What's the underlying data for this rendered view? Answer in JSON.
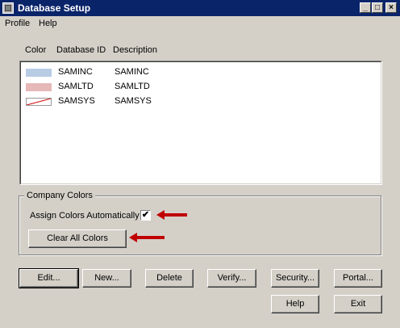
{
  "window": {
    "title": "Database Setup"
  },
  "titlebar": {
    "minimize": "_",
    "maximize": "□",
    "close": "×"
  },
  "menu": [
    "Profile",
    "Help"
  ],
  "list": {
    "headers": {
      "color": "Color",
      "id": "Database ID",
      "description": "Description"
    },
    "rows": [
      {
        "id": "SAMINC",
        "description": "SAMINC",
        "swatch": "#b8cce4"
      },
      {
        "id": "SAMLTD",
        "description": "SAMLTD",
        "swatch": "#e6b8b8"
      },
      {
        "id": "SAMSYS",
        "description": "SAMSYS",
        "swatch": "none"
      }
    ]
  },
  "company_colors": {
    "legend": "Company Colors",
    "assign_label": "Assign Colors Automatically",
    "assign_checked": "✔",
    "clear_button": "Clear All Colors"
  },
  "buttons": {
    "edit": "Edit...",
    "new": "New...",
    "delete": "Delete",
    "verify": "Verify...",
    "security": "Security...",
    "portal": "Portal...",
    "help": "Help",
    "exit": "Exit"
  },
  "colors": {
    "arrow": "#c00000"
  }
}
